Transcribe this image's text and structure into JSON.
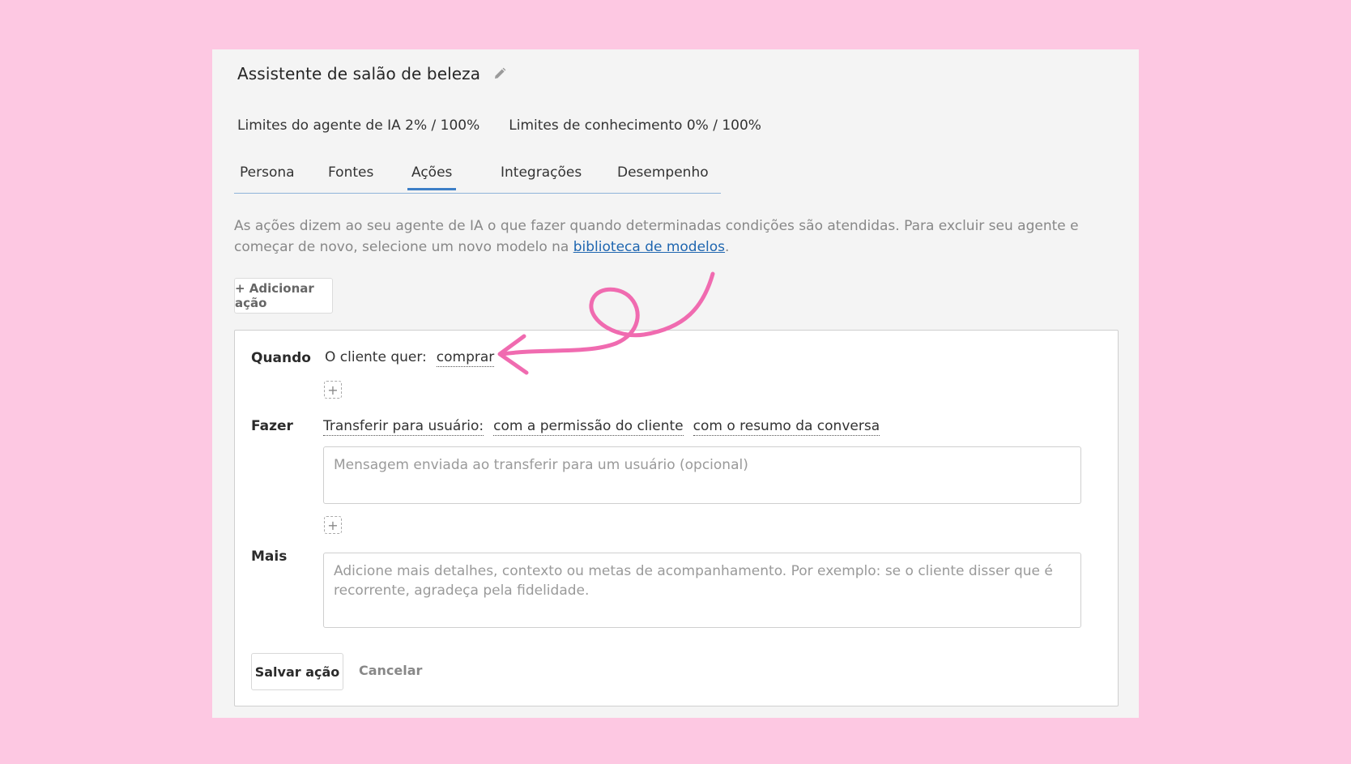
{
  "header": {
    "title": "Assistente de salão de beleza"
  },
  "limits": {
    "agent": "Limites do agente de IA 2% / 100%",
    "knowledge": "Limites de conhecimento 0% / 100%"
  },
  "tabs": [
    {
      "label": "Persona",
      "active": false
    },
    {
      "label": "Fontes",
      "active": false
    },
    {
      "label": "Ações",
      "active": true
    },
    {
      "label": "Integrações",
      "active": false
    },
    {
      "label": "Desempenho",
      "active": false
    }
  ],
  "description": {
    "text": "As ações dizem ao seu agente de IA o que fazer quando determinadas condições são atendidas. Para excluir seu agente e começar de novo, selecione um novo modelo na ",
    "link": "biblioteca de modelos",
    "suffix": "."
  },
  "add_action_label": "+ Adicionar ação",
  "action_card": {
    "when_label": "Quando",
    "condition_prefix": "O cliente quer:",
    "condition_value": "comprar",
    "do_label": "Fazer",
    "action_type": "Transferir para usuário:",
    "action_option_1": "com a permissão do cliente",
    "action_option_2": "com o resumo da conversa",
    "transfer_message_placeholder": "Mensagem enviada ao transferir para um usuário (opcional)",
    "more_label": "Mais",
    "more_placeholder": "Adicione mais detalhes, contexto ou metas de acompanhamento. Por exemplo: se o cliente disser que é recorrente, agradeça pela fidelidade.",
    "plus_symbol": "+",
    "save_label": "Salvar ação",
    "cancel_label": "Cancelar"
  },
  "colors": {
    "background": "#fdc8e2",
    "panel": "#f4f4f4",
    "tab_accent": "#3d7fc7",
    "link": "#1f66b0",
    "annotation_arrow": "#f06bb0"
  },
  "icons": {
    "edit": "pencil-icon",
    "annotation": "curly-arrow-annotation"
  }
}
